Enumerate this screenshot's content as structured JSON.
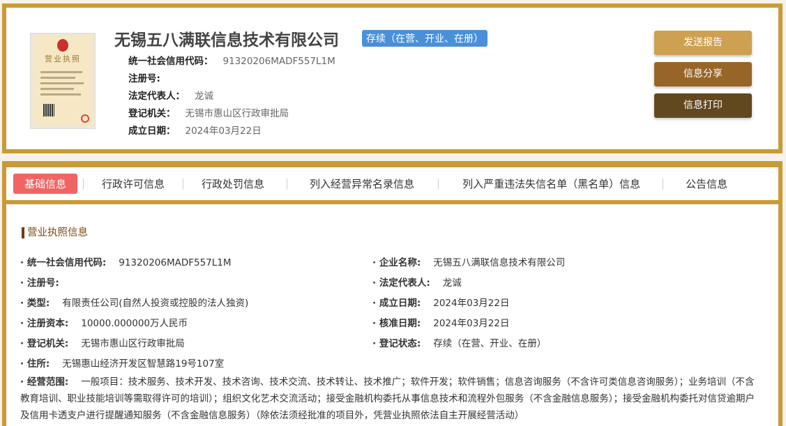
{
  "header": {
    "company_name": "无锡五八满联信息技术有限公司",
    "status": "存续（在营、开业、在册）",
    "rows": [
      {
        "label": "统一社会信用代码：",
        "value": "91320206MADF557L1M"
      },
      {
        "label": "注册号:",
        "value": ""
      },
      {
        "label": "法定代表人：",
        "value": "龙诚"
      },
      {
        "label": "登记机关：",
        "value": "无锡市惠山区行政审批局"
      },
      {
        "label": "成立日期：",
        "value": "2024年03月22日"
      }
    ],
    "buttons": {
      "send_report": "发送报告",
      "share": "信息分享",
      "print": "信息打印"
    },
    "colors": {
      "gold": "#c99a36",
      "btn1": "#cda052",
      "btn2": "#986528",
      "btn3": "#62481e"
    }
  },
  "tabs": [
    "基础信息",
    "行政许可信息",
    "行政处罚信息",
    "列入经营异常名录信息",
    "列入严重违法失信名单（黑名单）信息",
    "公告信息"
  ],
  "section": {
    "title": "营业执照信息",
    "left": [
      {
        "label": "统一社会信用代码:",
        "value": "91320206MADF557L1M"
      },
      {
        "label": "注册号:",
        "value": ""
      },
      {
        "label": "类型:",
        "value": "有限责任公司(自然人投资或控股的法人独资)"
      },
      {
        "label": "注册资本:",
        "value": "10000.000000万人民币"
      },
      {
        "label": "登记机关:",
        "value": "无锡市惠山区行政审批局"
      },
      {
        "label": "住所:",
        "value": "无锡惠山经济开发区智慧路19号107室"
      }
    ],
    "right": [
      {
        "label": "企业名称:",
        "value": "无锡五八满联信息技术有限公司"
      },
      {
        "label": "法定代表人:",
        "value": "龙诚"
      },
      {
        "label": "成立日期:",
        "value": "2024年03月22日"
      },
      {
        "label": "核准日期:",
        "value": "2024年03月22日"
      },
      {
        "label": "登记状态:",
        "value": "存续（在营、开业、在册）"
      }
    ],
    "scope_label": "经营范围:",
    "scope_value": "一般项目：技术服务、技术开发、技术咨询、技术交流、技术转让、技术推广；软件开发；软件销售；信息咨询服务（不含许可类信息咨询服务）；业务培训（不含教育培训、职业技能培训等需取得许可的培训）；组织文化艺术交流活动；接受金融机构委托从事信息技术和流程外包服务（不含金融信息服务）；接受金融机构委托对信贷逾期户及信用卡透支户进行提醒通知服务（不含金融信息服务）（除依法须经批准的项目外，凭营业执照依法自主开展经营活动）"
  }
}
